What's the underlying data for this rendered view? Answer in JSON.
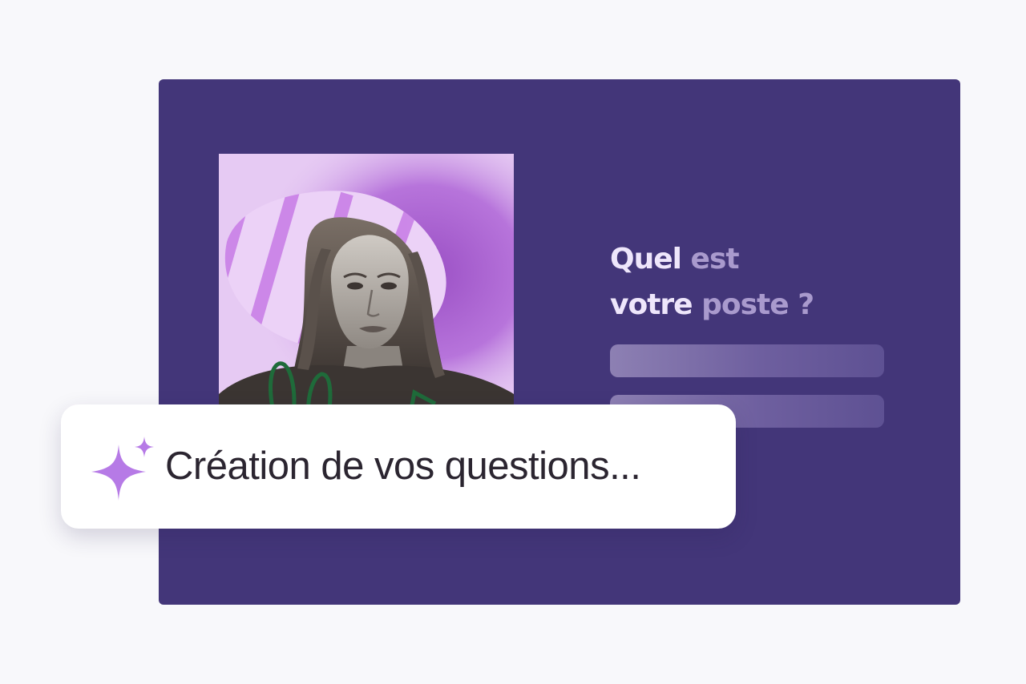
{
  "question": {
    "line1": {
      "strong": "Quel",
      "soft": " est"
    },
    "line2": {
      "strong": "votre",
      "soft": " poste ?"
    }
  },
  "toast": {
    "label": "Création de vos questions...",
    "icon": "sparkle-icon"
  },
  "colors": {
    "page_background": "#f8f8fb",
    "card_background": "#433679",
    "photo_background": "#e6caf3",
    "accent_purple": "#b67ae6",
    "question_strong": "#eee6fb",
    "question_soft": "#a99acd",
    "toast_text": "#2b2530"
  }
}
